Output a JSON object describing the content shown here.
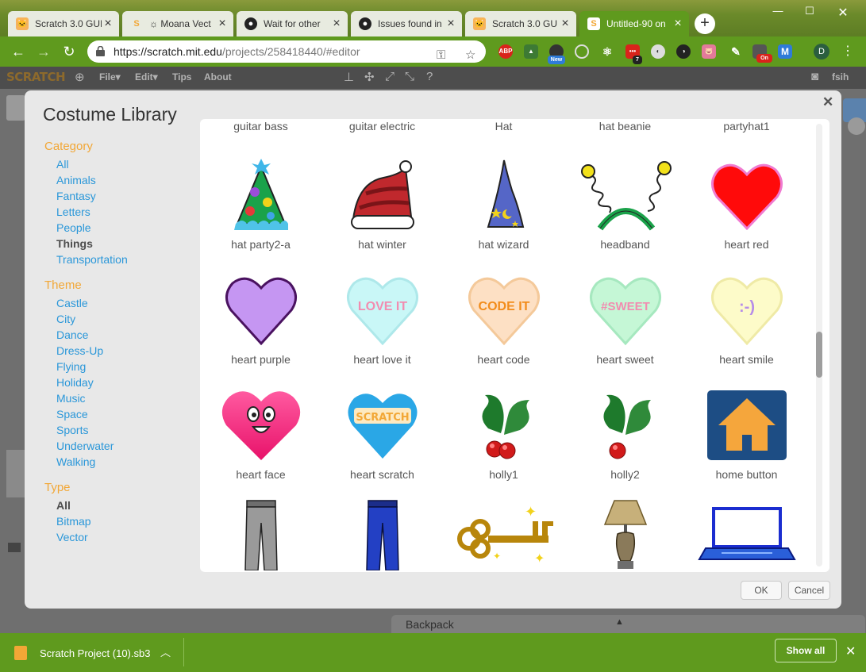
{
  "browser": {
    "tabs": [
      {
        "title": "Scratch 3.0 GUI",
        "icon": "scratch-cat-icon"
      },
      {
        "title": "☼ Moana Vect",
        "icon": "scratch-s-icon"
      },
      {
        "title": "Wait for other",
        "icon": "github-icon"
      },
      {
        "title": "Issues found in",
        "icon": "github-icon"
      },
      {
        "title": "Scratch 3.0 GU",
        "icon": "scratch-cat-icon"
      },
      {
        "title": "Untitled-90 on",
        "icon": "scratch-s-icon",
        "active": true
      }
    ],
    "url_host": "https://scratch.mit.edu",
    "url_path": "/projects/258418440/#editor",
    "extensions": [
      "ABP",
      "New",
      "7",
      "On",
      "M"
    ],
    "profile_initial": "D"
  },
  "scratch_menu": {
    "logo": "SCRATCH",
    "items": [
      "File▾",
      "Edit▾",
      "Tips",
      "About"
    ],
    "user": "fsih"
  },
  "dialog": {
    "title": "Costume Library",
    "category": {
      "title": "Category",
      "items": [
        "All",
        "Animals",
        "Fantasy",
        "Letters",
        "People",
        "Things",
        "Transportation"
      ],
      "selected": "Things"
    },
    "theme": {
      "title": "Theme",
      "items": [
        "Castle",
        "City",
        "Dance",
        "Dress-Up",
        "Flying",
        "Holiday",
        "Music",
        "Space",
        "Sports",
        "Underwater",
        "Walking"
      ]
    },
    "type": {
      "title": "Type",
      "items": [
        "All",
        "Bitmap",
        "Vector"
      ],
      "selected": "All"
    },
    "top_labels": [
      "guitar bass",
      "guitar electric",
      "Hat",
      "hat beanie",
      "partyhat1"
    ],
    "costumes": [
      {
        "name": "hat party2-a"
      },
      {
        "name": "hat winter"
      },
      {
        "name": "hat wizard"
      },
      {
        "name": "headband"
      },
      {
        "name": "heart red"
      },
      {
        "name": "heart purple"
      },
      {
        "name": "heart love it",
        "text": "LOVE IT"
      },
      {
        "name": "heart code",
        "text": "CODE IT"
      },
      {
        "name": "heart sweet",
        "text": "#SWEET"
      },
      {
        "name": "heart smile",
        "text": ":-)"
      },
      {
        "name": "heart face"
      },
      {
        "name": "heart scratch",
        "text": "SCRATCH"
      },
      {
        "name": "holly1"
      },
      {
        "name": "holly2"
      },
      {
        "name": "home button"
      }
    ],
    "ok_label": "OK",
    "cancel_label": "Cancel"
  },
  "editor": {
    "backpack_label": "Backpack",
    "backpack_arrow": "▲"
  },
  "download_bar": {
    "file_name": "Scratch Project (10).sb3",
    "show_all": "Show all"
  }
}
